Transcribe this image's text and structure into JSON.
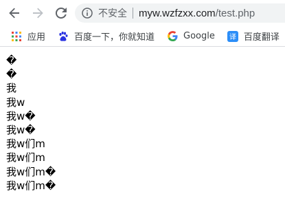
{
  "browser": {
    "nav": {
      "back_icon": "arrow-left-icon",
      "forward_icon": "arrow-right-icon",
      "reload_icon": "reload-icon"
    },
    "omnibox": {
      "security_label": "不安全",
      "url_host": "myw.wzfzxx.com",
      "url_path": "/test.php"
    }
  },
  "bookmarks": [
    {
      "label": "应用",
      "icon": "apps-grid-icon"
    },
    {
      "label": "百度一下，你就知道",
      "icon": "baidu-paw-icon"
    },
    {
      "label": "Google",
      "icon": "google-g-icon"
    },
    {
      "label": "百度翻译",
      "icon": "translate-icon"
    }
  ],
  "page_output": {
    "lines": [
      "�",
      "�",
      "我",
      "我w",
      "我w�",
      "我w�",
      "我w们m",
      "我w们m",
      "我w们m�",
      "我w们m�"
    ]
  },
  "colors": {
    "toolbar_icon": "#5f6368",
    "omnibox_bg": "#f1f3f4",
    "google_blue": "#4285f4",
    "baidu_blue": "#2932e1",
    "translate_blue": "#2c8ef8"
  }
}
